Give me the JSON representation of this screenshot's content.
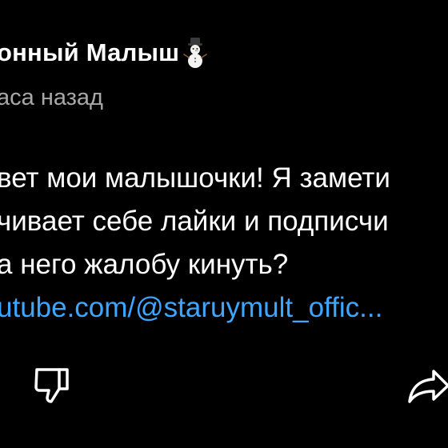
{
  "comment": {
    "author_name": "онный Малыш",
    "author_emoji": "snowman-icon",
    "timestamp": "аса назад",
    "lines": [
      "вет мои малышочки! Я замети",
      "чивает себе лайки и подписчи",
      "а него жалобу кинуть?"
    ],
    "link_text": "utube.com/@staruymult_offic..."
  },
  "actions": {
    "dislike_icon": "thumbs-down-icon",
    "share_icon": "share-icon"
  },
  "colors": {
    "background": "#000000",
    "text": "#ffffff",
    "secondary_text": "#a8a8a8",
    "link": "#3ea6ff"
  }
}
